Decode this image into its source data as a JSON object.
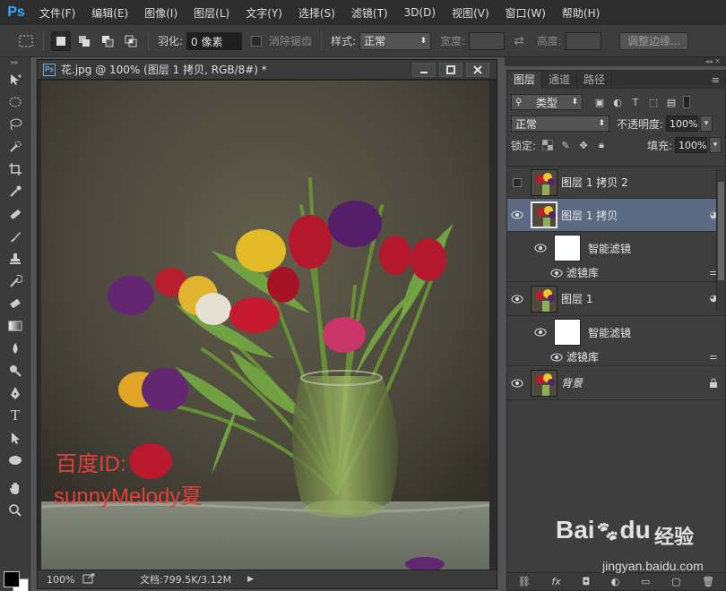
{
  "app": {
    "logo": "Ps"
  },
  "menu": [
    "文件(F)",
    "编辑(E)",
    "图像(I)",
    "图层(L)",
    "文字(Y)",
    "选择(S)",
    "滤镜(T)",
    "3D(D)",
    "视图(V)",
    "窗口(W)",
    "帮助(H)"
  ],
  "options": {
    "feather_label": "羽化:",
    "feather_value": "0 像素",
    "antialias_label": "消除锯齿",
    "style_label": "样式:",
    "style_value": "正常",
    "width_label": "宽度:",
    "height_label": "高度:",
    "refine_button": "调整边缘..."
  },
  "document": {
    "title": "花.jpg @ 100% (图层 1 拷贝, RGB/8#) *",
    "zoom": "100%",
    "doc_size": "文档:799.5K/3.12M",
    "watermark_line1": "百度ID:",
    "watermark_line2": "sunnyMelody夏"
  },
  "layers_panel": {
    "tabs": [
      "图层",
      "通道",
      "路径"
    ],
    "kind_filter": "类型",
    "blend_mode": "正常",
    "opacity_label": "不透明度:",
    "opacity_value": "100%",
    "lock_label": "锁定:",
    "fill_label": "填充:",
    "fill_value": "100%",
    "layers": [
      {
        "name": "图层 1 拷贝 2",
        "visible": false,
        "selected": false
      },
      {
        "name": "图层 1 拷贝",
        "visible": true,
        "selected": true
      },
      {
        "name": "智能滤镜",
        "visible": true,
        "type": "smart-filter"
      },
      {
        "name": "滤镜库",
        "visible": true,
        "type": "filter"
      },
      {
        "name": "图层 1",
        "visible": true,
        "selected": false
      },
      {
        "name": "智能滤镜",
        "visible": true,
        "type": "smart-filter"
      },
      {
        "name": "滤镜库",
        "visible": true,
        "type": "filter"
      },
      {
        "name": "背景",
        "visible": true,
        "locked": true
      }
    ]
  },
  "watermark": {
    "logo": "Bai",
    "logo_du": "du",
    "suffix": "经验",
    "url": "jingyan.baidu.com"
  }
}
